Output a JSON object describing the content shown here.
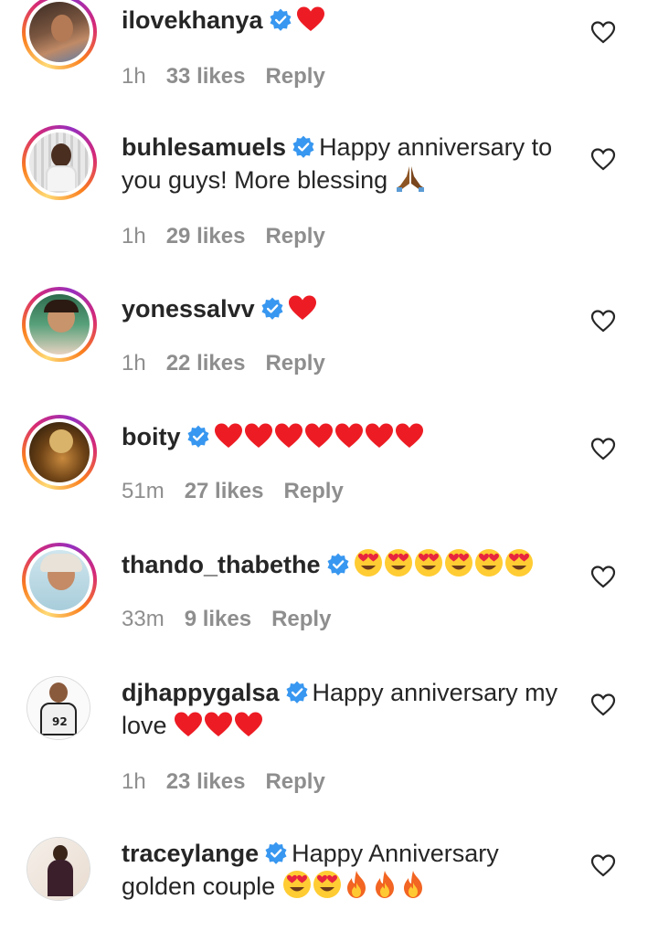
{
  "comments": [
    {
      "username": "ilovekhanya",
      "text": "",
      "emojis": [
        "heart"
      ],
      "time": "1h",
      "likes": "33 likes",
      "reply": "Reply"
    },
    {
      "username": "buhlesamuels",
      "text": "Happy anniversary to you guys! More blessing",
      "emojis": [
        "pray"
      ],
      "time": "1h",
      "likes": "29 likes",
      "reply": "Reply"
    },
    {
      "username": "yonessalvv",
      "text": "",
      "emojis": [
        "heart"
      ],
      "time": "1h",
      "likes": "22 likes",
      "reply": "Reply"
    },
    {
      "username": "boity",
      "text": "",
      "emojis": [
        "heart",
        "heart",
        "heart",
        "heart",
        "heart",
        "heart",
        "heart"
      ],
      "time": "51m",
      "likes": "27 likes",
      "reply": "Reply"
    },
    {
      "username": "thando_thabethe",
      "text": "",
      "emojis": [
        "heart-eyes",
        "heart-eyes",
        "heart-eyes",
        "heart-eyes",
        "heart-eyes",
        "heart-eyes"
      ],
      "time": "33m",
      "likes": "9 likes",
      "reply": "Reply"
    },
    {
      "username": "djhappygalsa",
      "text": "Happy anniversary my love",
      "emojis": [
        "heart",
        "heart",
        "heart"
      ],
      "time": "1h",
      "likes": "23 likes",
      "reply": "Reply"
    },
    {
      "username": "traceylange",
      "text": "Happy Anniversary golden couple",
      "emojis": [
        "heart-eyes",
        "heart-eyes",
        "fire",
        "fire",
        "fire"
      ],
      "time": "",
      "likes": "",
      "reply": ""
    }
  ],
  "colors": {
    "verified": "#3897f0",
    "heart": "#ed1c24",
    "meta": "#8e8e8e",
    "text": "#262626"
  }
}
